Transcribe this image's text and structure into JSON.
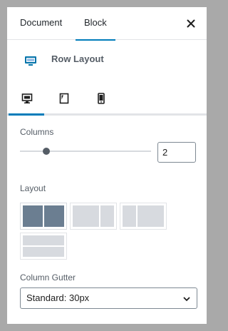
{
  "header": {
    "tabs": [
      {
        "label": "Document"
      },
      {
        "label": "Block"
      }
    ],
    "active_tab": "Block",
    "close_icon": "close-icon"
  },
  "block": {
    "title": "Row Layout",
    "icon": "row-layout-icon",
    "icon_color": "#0073aa"
  },
  "device_tabs": {
    "items": [
      "desktop-icon",
      "tablet-icon",
      "mobile-icon"
    ],
    "active": "desktop-icon",
    "accent": "#007cba"
  },
  "columns": {
    "label": "Columns",
    "value": "2",
    "slider_value": 2,
    "slider_min": 1,
    "slider_max": 6
  },
  "layout": {
    "label": "Layout",
    "options": [
      {
        "name": "equal-halves",
        "ratios": [
          1,
          1
        ],
        "selected": true
      },
      {
        "name": "left-heavy",
        "ratios": [
          2,
          1
        ],
        "selected": false
      },
      {
        "name": "right-heavy",
        "ratios": [
          1,
          2
        ],
        "selected": false
      },
      {
        "name": "collapse-rows",
        "ratios": [
          1,
          1
        ],
        "selected": false
      }
    ],
    "selected_color": "#6b7e91",
    "unselected_color": "#d7dadf"
  },
  "gutter": {
    "label": "Column Gutter",
    "selected": "Standard: 30px"
  }
}
